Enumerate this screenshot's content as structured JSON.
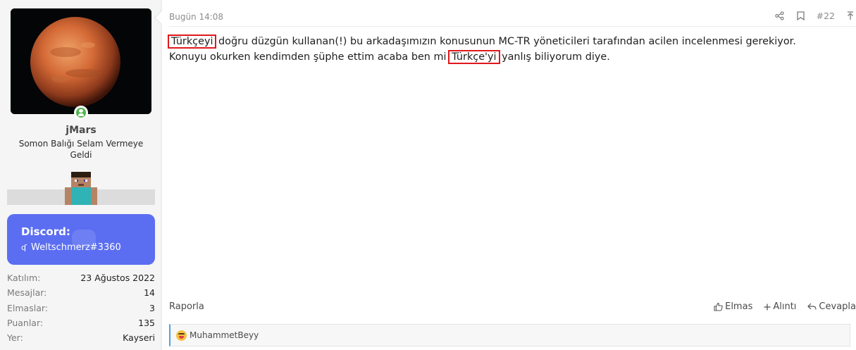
{
  "post": {
    "date": "Bugün 14:08",
    "number": "#22",
    "body": {
      "hl1": "Türkçeyi",
      "part1": " doğru düzgün kullanan(!) bu arkadaşımızın konusunun MC-TR yöneticileri tarafından acilen incelenmesi gerekiyor.",
      "part2": "Konuyu okurken kendimden şüphe ettim acaba ben mi ",
      "hl2": "Türkçe'yi",
      "part3": " yanlış biliyorum diye."
    },
    "report": "Raporla",
    "actions": {
      "like": "Elmas",
      "quote": "Alıntı",
      "reply": "Cevapla"
    },
    "reaction_user": "MuhammetBeyy"
  },
  "user": {
    "name": "jMars",
    "title": "Somon Balığı Selam Vermeye Geldi",
    "discord_title": "Discord:",
    "discord_name": "Weltschmerz#3360",
    "stats": [
      {
        "label": "Katılım:",
        "value": "23 Ağustos 2022"
      },
      {
        "label": "Mesajlar:",
        "value": "14"
      },
      {
        "label": "Elmaslar:",
        "value": "3"
      },
      {
        "label": "Puanlar:",
        "value": "135"
      },
      {
        "label": "Yer:",
        "value": "Kayseri"
      }
    ]
  },
  "colors": {
    "discord": "#5b6ef2",
    "highlight": "#e0181b",
    "reaction_bar": "#4aa3e6"
  },
  "icons": [
    "share-icon",
    "bookmark-icon",
    "jump-top-icon",
    "thumbs-up-icon",
    "plus-icon",
    "reply-icon",
    "online-user-icon",
    "laugh-emoji-icon"
  ]
}
